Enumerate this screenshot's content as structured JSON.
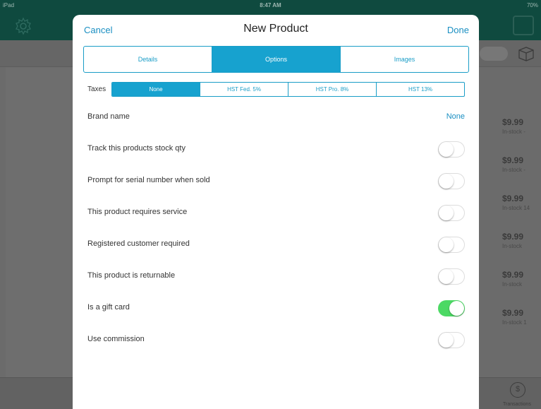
{
  "status_bar": {
    "left": "iPad",
    "time": "8:47 AM",
    "right": "70%"
  },
  "background": {
    "prices": [
      {
        "amount": "$9.99",
        "sub": "In-stock -"
      },
      {
        "amount": "$9.99",
        "sub": "In-stock -"
      },
      {
        "amount": "$9.99",
        "sub": "In-stock 14"
      },
      {
        "amount": "$9.99",
        "sub": "In-stock"
      },
      {
        "amount": "$9.99",
        "sub": "In-stock"
      },
      {
        "amount": "$9.99",
        "sub": "In-stock 1"
      }
    ],
    "dollar_icon_text": "$",
    "transactions_label": "Transactions"
  },
  "modal": {
    "cancel_label": "Cancel",
    "title": "New Product",
    "done_label": "Done",
    "tabs": [
      {
        "label": "Details",
        "active": false
      },
      {
        "label": "Options",
        "active": true
      },
      {
        "label": "Images",
        "active": false
      }
    ],
    "taxes": {
      "label": "Taxes",
      "options": [
        {
          "label": "None",
          "active": true
        },
        {
          "label": "HST Fed. 5%",
          "active": false
        },
        {
          "label": "HST Pro. 8%",
          "active": false
        },
        {
          "label": "HST 13%",
          "active": false
        }
      ]
    },
    "brand": {
      "label": "Brand name",
      "value": "None"
    },
    "toggles": [
      {
        "label": "Track this products stock qty",
        "on": false
      },
      {
        "label": "Prompt for serial number when sold",
        "on": false
      },
      {
        "label": "This product requires service",
        "on": false
      },
      {
        "label": "Registered customer required",
        "on": false
      },
      {
        "label": "This product is returnable",
        "on": false
      },
      {
        "label": "Is a gift card",
        "on": true
      },
      {
        "label": "Use commission",
        "on": false
      }
    ]
  },
  "colors": {
    "accent": "#17a2cf",
    "toggle_on": "#4cd964",
    "link": "#1a8fc2"
  }
}
